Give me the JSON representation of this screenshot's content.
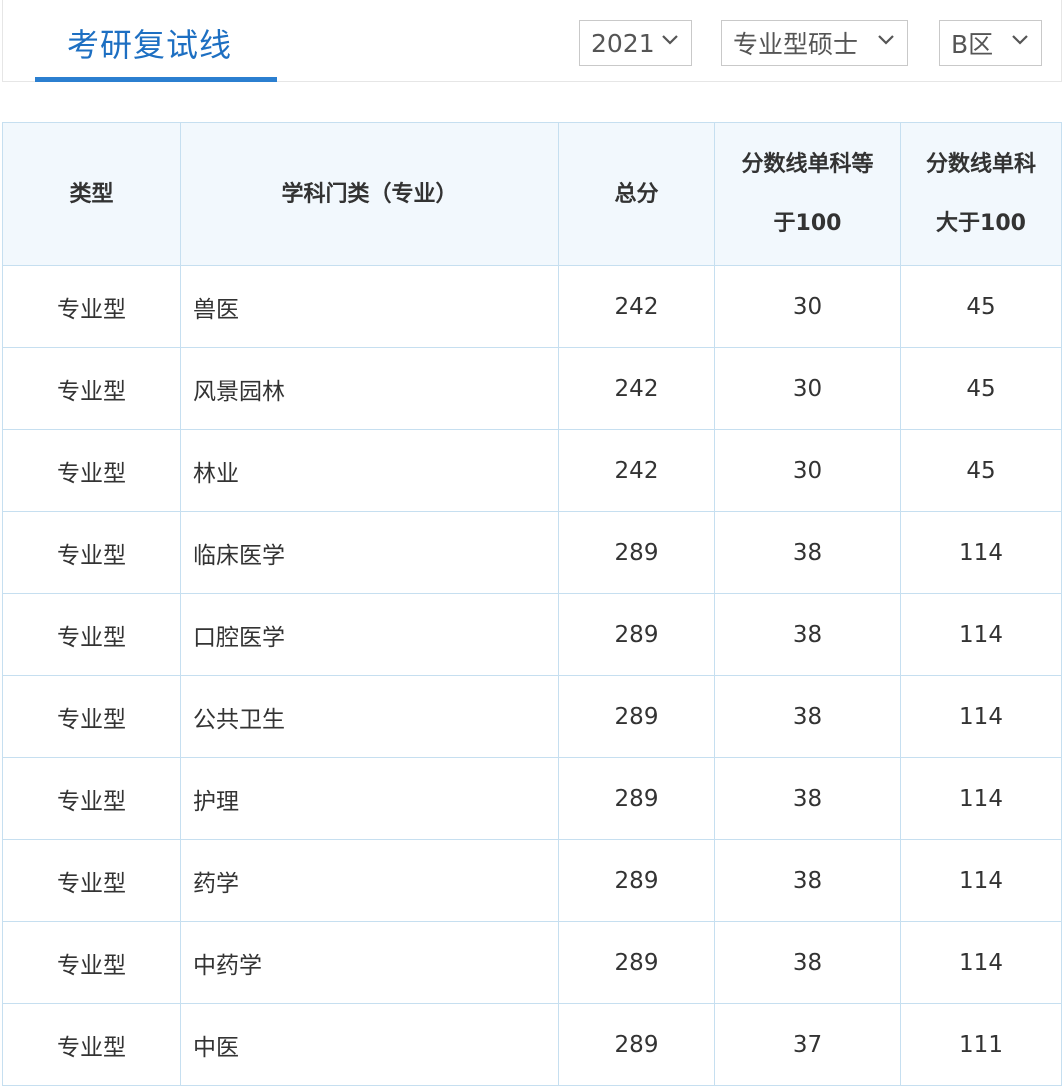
{
  "header": {
    "title": "考研复试线",
    "year_select": {
      "value": "2021",
      "icon": "chevron-down-icon"
    },
    "type_select": {
      "value": "专业型硕士",
      "icon": "chevron-down-icon"
    },
    "zone_select": {
      "value": "B区",
      "icon": "chevron-down-icon"
    }
  },
  "table": {
    "columns": {
      "type": "类型",
      "subject": "学科门类（专业）",
      "total": "总分",
      "single_eq100_line1": "分数线单科等",
      "single_eq100_line2": "于100",
      "single_gt100_line1": "分数线单科",
      "single_gt100_line2": "大于100"
    },
    "rows": [
      {
        "type": "专业型",
        "subject": "兽医",
        "total": "242",
        "eq100": "30",
        "gt100": "45"
      },
      {
        "type": "专业型",
        "subject": "风景园林",
        "total": "242",
        "eq100": "30",
        "gt100": "45"
      },
      {
        "type": "专业型",
        "subject": "林业",
        "total": "242",
        "eq100": "30",
        "gt100": "45"
      },
      {
        "type": "专业型",
        "subject": "临床医学",
        "total": "289",
        "eq100": "38",
        "gt100": "114"
      },
      {
        "type": "专业型",
        "subject": "口腔医学",
        "total": "289",
        "eq100": "38",
        "gt100": "114"
      },
      {
        "type": "专业型",
        "subject": "公共卫生",
        "total": "289",
        "eq100": "38",
        "gt100": "114"
      },
      {
        "type": "专业型",
        "subject": "护理",
        "total": "289",
        "eq100": "38",
        "gt100": "114"
      },
      {
        "type": "专业型",
        "subject": "药学",
        "total": "289",
        "eq100": "38",
        "gt100": "114"
      },
      {
        "type": "专业型",
        "subject": "中药学",
        "total": "289",
        "eq100": "38",
        "gt100": "114"
      },
      {
        "type": "专业型",
        "subject": "中医",
        "total": "289",
        "eq100": "37",
        "gt100": "111"
      }
    ]
  },
  "colors": {
    "accent": "#2b7fd0",
    "title": "#1d6fc2",
    "header_bg": "#f2f8fd",
    "border": "#c6dff0"
  }
}
